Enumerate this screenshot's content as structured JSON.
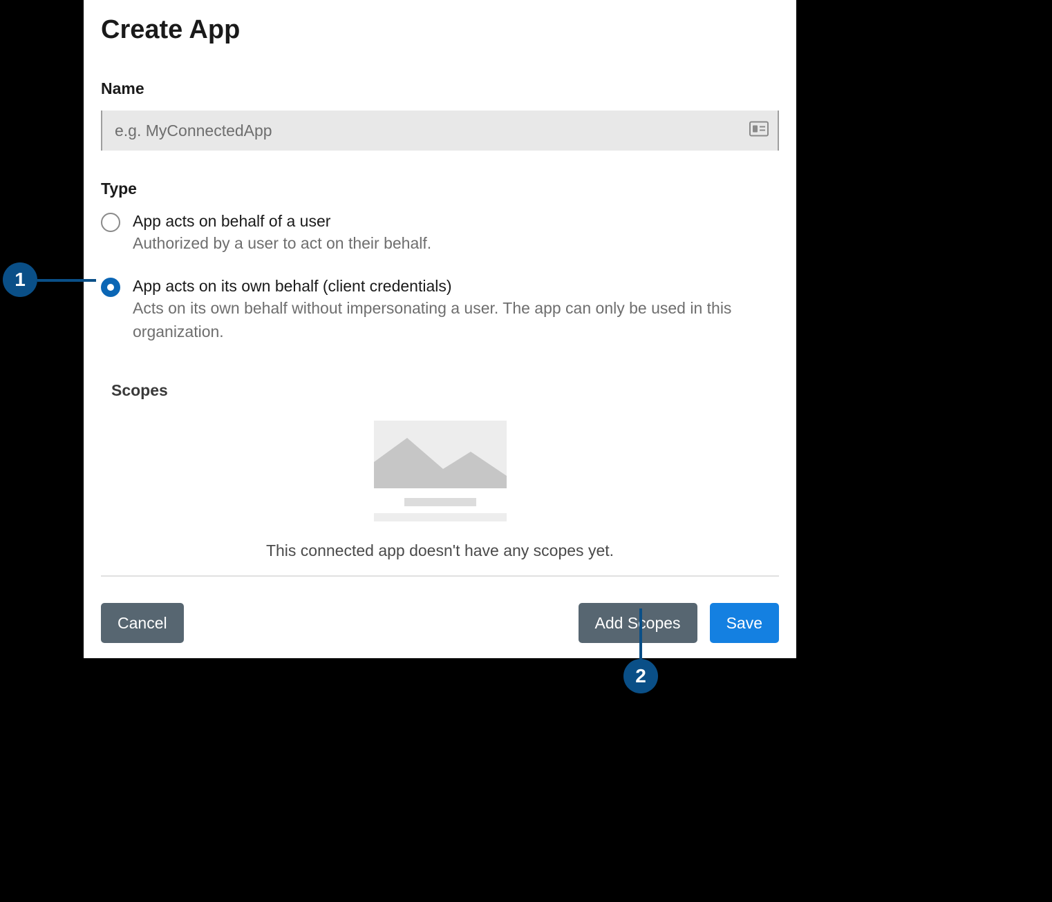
{
  "dialog": {
    "title": "Create App",
    "name": {
      "label": "Name",
      "placeholder": "e.g. MyConnectedApp"
    },
    "type": {
      "label": "Type",
      "options": [
        {
          "title": "App acts on behalf of a user",
          "description": "Authorized by a user to act on their behalf.",
          "selected": false
        },
        {
          "title": "App acts on its own behalf (client credentials)",
          "description": "Acts on its own behalf without impersonating a user. The app can only be used in this organization.",
          "selected": true
        }
      ]
    },
    "scopes": {
      "label": "Scopes",
      "empty_message": "This connected app doesn't have any scopes yet."
    },
    "buttons": {
      "cancel": "Cancel",
      "add_scopes": "Add Scopes",
      "save": "Save"
    }
  },
  "annotations": {
    "callout1": "1",
    "callout2": "2"
  }
}
